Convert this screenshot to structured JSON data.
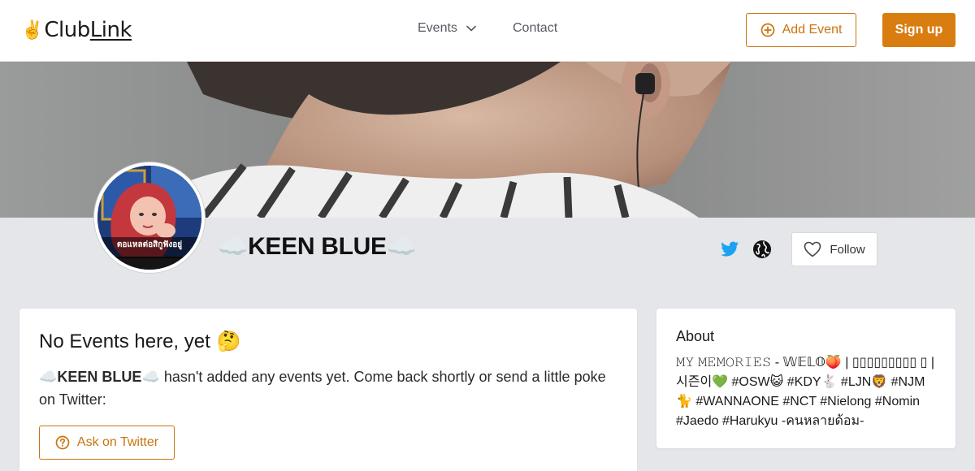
{
  "header": {
    "logo_mark": "✌️",
    "logo_text_a": "Club",
    "logo_text_b": "Link",
    "nav": {
      "events_label": "Events",
      "contact_label": "Contact"
    },
    "add_event_label": "Add Event",
    "signup_label": "Sign up"
  },
  "profile": {
    "cloud_emoji": "☁️",
    "name": "KEEN BLUE",
    "avatar_caption": "ตอแหลต่อสิกูฟังอยู่",
    "follow_label": "Follow"
  },
  "events": {
    "heading": "No Events here, yet",
    "heading_emoji": "🤔",
    "empty_cloud": "☁️",
    "empty_name": "KEEN BLUE",
    "empty_message": " hasn't added any events yet. Come back shortly or send a little poke on Twitter:",
    "ask_label": "Ask on Twitter"
  },
  "about": {
    "heading": "About",
    "text": "𝙼𝚈 𝙼𝙴𝙼𝙾𝚁𝙸𝙴𝚂 - 𝕎𝔼𝕃𝕆🍑 | ▯▯▯▯▯▯▯▯▯ ▯ |시즌이💚 #OSW😺 #KDY🐇 #LJN🦁 #NJM🐈 #WANNAONE #NCT #Nielong #Nomin #Jaedo #Harukyu -คนหลายด้อม-"
  },
  "colors": {
    "accent": "#d97d10",
    "accent_text": "#c87410",
    "twitter": "#1da1f2",
    "page_bg": "#e5e6ea"
  },
  "icons": {
    "events_chevron": "chevron-down-icon",
    "add": "plus-circle-icon",
    "twitter": "twitter-icon",
    "website": "globe-icon",
    "follow": "heart-icon",
    "ask": "question-circle-icon"
  }
}
